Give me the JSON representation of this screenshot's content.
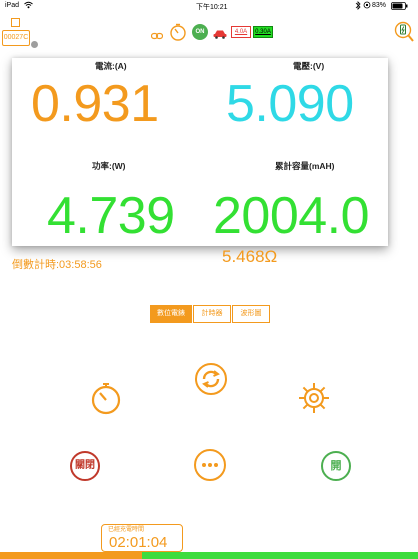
{
  "status_bar": {
    "carrier": "iPad",
    "time": "下午10:21",
    "battery": "83%"
  },
  "header": {
    "device_id": "00027C",
    "on_badge": "ON",
    "limit_1": "4.0A",
    "limit_2": "0.30A"
  },
  "meters": {
    "current_label": "電流:(A)",
    "current_value": "0.931",
    "voltage_label": "電壓:(V)",
    "voltage_value": "5.090",
    "power_label": "功率:(W)",
    "power_value": "4.739",
    "capacity_label": "累計容量(mAH)",
    "capacity_value": "2004.0",
    "resistance": "5.468Ω",
    "countdown": "倒數計時:03:58:56"
  },
  "tabs": [
    "數位電錶",
    "計時器",
    "波形圖"
  ],
  "controls": {
    "off_label": "關閉",
    "on_label": "開"
  },
  "footer": {
    "elapsed_label": "已經充電時間",
    "elapsed_time": "02:01:04",
    "progress": 0.34
  },
  "colors": {
    "accent_orange": "#f39a1e",
    "cyan": "#2fd9e6",
    "green": "#33e033",
    "red": "#c0392b",
    "on_green": "#4caf50"
  }
}
